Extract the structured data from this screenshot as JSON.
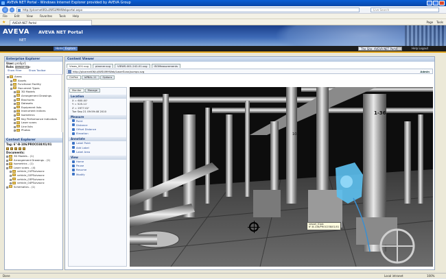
{
  "browser": {
    "title": "AVEVA NET Portal - Windows Internet Explorer provided by AVEVA Group",
    "address": "http://plcarnet06/ui/WSUMHWebportal.aspx",
    "search_placeholder": "Live Search",
    "menu": [
      "File",
      "Edit",
      "View",
      "Favorites",
      "Tools",
      "Help"
    ],
    "tab_label": "AVEVA NET Portal",
    "tools": [
      "Page",
      "Tools"
    ]
  },
  "header": {
    "logo": "AVEVA",
    "logo_sub": "NET",
    "portal_title": "AVEVA NET Portal",
    "tabs": [
      "Home",
      "Explore"
    ],
    "site_label": "The Site: AVEVA NET Portal",
    "util": "Help  Logout"
  },
  "explorer": {
    "title": "Enterprise Explorer",
    "user_label": "User:",
    "user_value": "proSpr1",
    "role_label": "Role:",
    "role_value": "Default User",
    "show_label": "Show Filter",
    "show_toolbar": "Show Toolbar",
    "tree": [
      {
        "label": "Areas",
        "depth": 0
      },
      {
        "label": "Assets",
        "depth": 1
      },
      {
        "label": "Functional Facility",
        "depth": 1
      },
      {
        "label": "Document Types",
        "depth": 1
      },
      {
        "label": "3D Models",
        "depth": 2
      },
      {
        "label": "Arrangement Drawings",
        "depth": 2
      },
      {
        "label": "Brochures",
        "depth": 2
      },
      {
        "label": "Datasets",
        "depth": 2
      },
      {
        "label": "Equipment lists",
        "depth": 2
      },
      {
        "label": "Instrument indices",
        "depth": 2
      },
      {
        "label": "Isometrics",
        "depth": 2
      },
      {
        "label": "Key Performance Indicators",
        "depth": 2
      },
      {
        "label": "Laser scans",
        "depth": 2
      },
      {
        "label": "Line lists",
        "depth": 2
      },
      {
        "label": "Photos",
        "depth": 2
      },
      {
        "label": "Views_001",
        "depth": 3,
        "selected": true
      },
      {
        "label": "Photographs",
        "depth": 2
      },
      {
        "label": "Schematics",
        "depth": 2
      }
    ]
  },
  "context": {
    "title": "Context Explorer",
    "tag_label": "Tag:",
    "tag_value": "6\"-B-106/PROC038/01/01",
    "documents_label": "Documents:",
    "items": [
      {
        "label": "3D Models - (1)",
        "depth": 0
      },
      {
        "label": "Arrangement Drawings - (2)",
        "depth": 0
      },
      {
        "label": "Isometrics - (1)",
        "depth": 0
      },
      {
        "label": "Laser scans - (4)",
        "depth": 0
      },
      {
        "label": "vehicle_01PSuivaunc",
        "depth": 1
      },
      {
        "label": "vehicle_02PSuivaunc",
        "depth": 1
      },
      {
        "label": "vehicle_03PSuivaunc",
        "depth": 1
      },
      {
        "label": "vehicle_04PSuivaunc",
        "depth": 1
      },
      {
        "label": "Schematics - (1)",
        "depth": 0
      }
    ]
  },
  "viewer": {
    "title": "Content Viewer",
    "doc_tabs": [
      "Views_001.svg",
      "planner.svg",
      "VIEWS-001-242-01.svg",
      "ISOMeasurements"
    ],
    "path": "http://plcarnet06/ui/WSUMHWeb/LaserScan/pumps.svg",
    "help_label": "Admin",
    "subtabs": [
      "CtrlPak",
      "IsPBAL-11",
      "Options"
    ],
    "panel_tabs": [
      "Monitor",
      "Manage"
    ],
    "location_head": "Location",
    "location": [
      "X = 600.00'",
      "Y = 525.11'",
      "Z = 2977.02'",
      "Tue Sep 21 09:59:48 2010"
    ],
    "measure_head": "Measure",
    "measure": [
      "Point",
      "Distance",
      "Offset Distance",
      "Elevation"
    ],
    "annotate_head": "Annotate",
    "annotate": [
      "Label Point",
      "Add Label",
      "Label Area"
    ],
    "view_head": "View",
    "view_items": [
      "Home",
      "Pause",
      "Resume",
      "Modify"
    ],
    "tag_popup_1": "vessel_01pb",
    "tag_popup_2": "6\"-B-106/PROC038/01/01"
  },
  "statusbar": {
    "status": "Done",
    "zone": "Local intranet",
    "zoom": "100%"
  },
  "colors": {
    "accent": "#1a3f8a",
    "header_strip": "#1c1c1c",
    "highlight_cyan": "#5cc0ef",
    "rule_yellow": "#e3a51c"
  }
}
